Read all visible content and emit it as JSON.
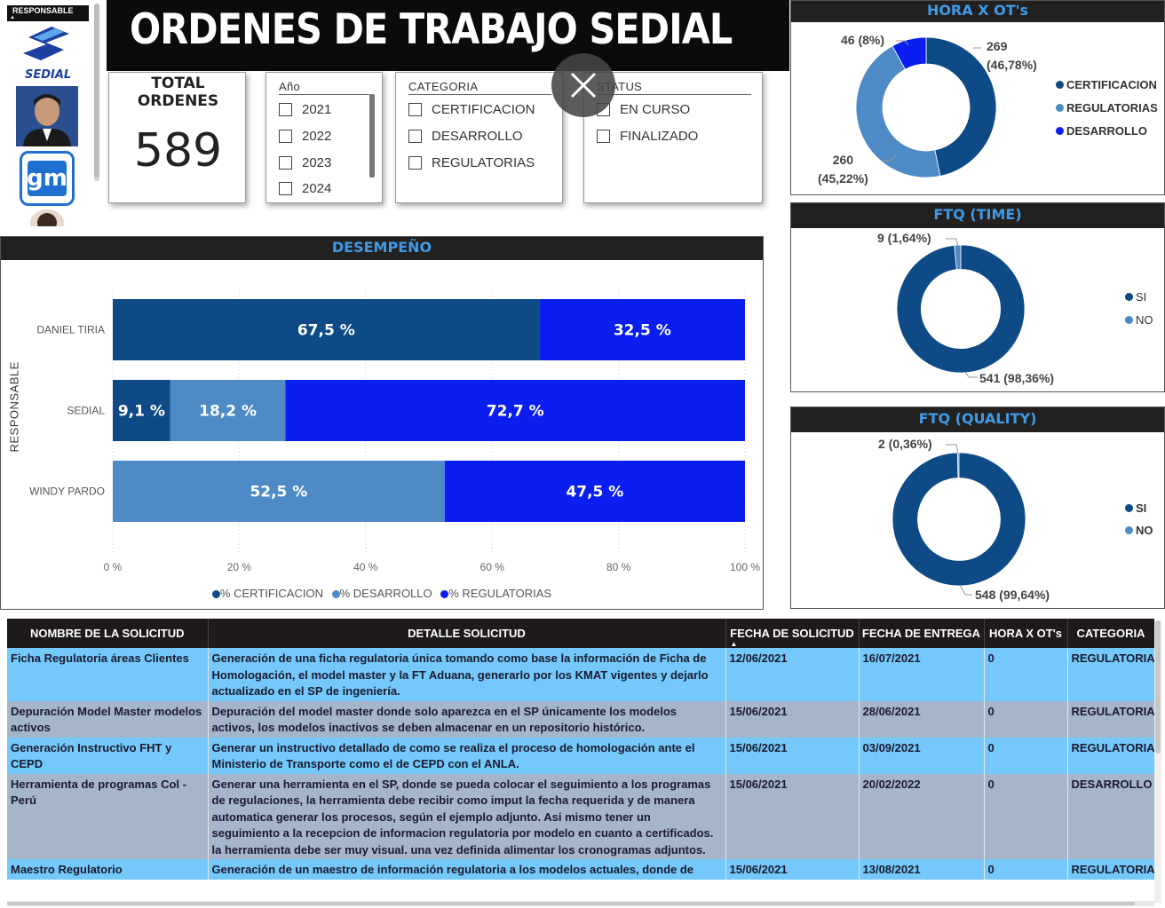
{
  "title": "ORDENES DE TRABAJO SEDIAL",
  "responsable_slicer": {
    "header": "RESPONSABLE",
    "logo_text": "SEDIAL",
    "gm_logo_text": "gm"
  },
  "kpi": {
    "label": "TOTAL ORDENES",
    "value": "589"
  },
  "slicers": {
    "anio": {
      "title": "Año",
      "options": [
        "2021",
        "2022",
        "2023",
        "2024"
      ]
    },
    "categoria": {
      "title": "CATEGORIA",
      "options": [
        "CERTIFICACION",
        "DESARROLLO",
        "REGULATORIAS"
      ]
    },
    "status": {
      "title": "STATUS",
      "options": [
        "EN CURSO",
        "FINALIZADO"
      ]
    }
  },
  "desempeno": {
    "title": "DESEMPEÑO",
    "y_axis_label": "RESPONSABLE",
    "legend": [
      "% CERTIFICACION",
      "% DESARROLLO",
      "% REGULATORIAS"
    ]
  },
  "hora_ot": {
    "title": "HORA X OT's",
    "labels": {
      "desarrollo": "46 (8%)",
      "cert_v": "269",
      "cert_p": "(46,78%)",
      "reg_v": "260",
      "reg_p": "(45,22%)"
    },
    "legend": [
      "CERTIFICACION",
      "REGULATORIAS",
      "DESARROLLO"
    ]
  },
  "ftq_time": {
    "title": "FTQ (TIME)",
    "labels": {
      "no": "9 (1,64%)",
      "si": "541 (98,36%)"
    },
    "legend": [
      "SI",
      "NO"
    ]
  },
  "ftq_quality": {
    "title": "FTQ (QUALITY)",
    "labels": {
      "no": "2 (0,36%)",
      "si": "548 (99,64%)"
    },
    "legend": [
      "SI",
      "NO"
    ]
  },
  "chart_data": [
    {
      "type": "bar",
      "title": "DESEMPEÑO",
      "stacked": "100%",
      "orientation": "horizontal",
      "ylabel": "RESPONSABLE",
      "categories": [
        "DANIEL TIRIA",
        "SEDIAL",
        "WINDY PARDO"
      ],
      "series": [
        {
          "name": "% CERTIFICACION",
          "color": "#0d4a86",
          "values": [
            67.5,
            9.1,
            0
          ]
        },
        {
          "name": "% DESARROLLO",
          "color": "#4d8ac6",
          "values": [
            0,
            18.2,
            52.5
          ]
        },
        {
          "name": "% REGULATORIAS",
          "color": "#0a1ef0",
          "values": [
            32.5,
            72.7,
            47.5
          ]
        }
      ],
      "data_labels": [
        [
          "67,5 %",
          "",
          "32,5 %"
        ],
        [
          "9,1 %",
          "18,2 %",
          "72,7 %"
        ],
        [
          "",
          "52,5 %",
          "47,5 %"
        ]
      ],
      "xlim": [
        0,
        100
      ],
      "xticks": [
        "0 %",
        "20 %",
        "40 %",
        "60 %",
        "80 %",
        "100 %"
      ],
      "legend_position": "bottom",
      "grid": true
    },
    {
      "type": "pie",
      "title": "HORA X OT's",
      "donut": true,
      "categories": [
        "CERTIFICACION",
        "REGULATORIAS",
        "DESARROLLO"
      ],
      "values": [
        269,
        260,
        46
      ],
      "colors": [
        "#0d4a86",
        "#4d8ac6",
        "#0a1ef0"
      ]
    },
    {
      "type": "pie",
      "title": "FTQ (TIME)",
      "donut": true,
      "categories": [
        "SI",
        "NO"
      ],
      "values": [
        541,
        9
      ],
      "colors": [
        "#0d4a86",
        "#4d8ac6"
      ]
    },
    {
      "type": "pie",
      "title": "FTQ (QUALITY)",
      "donut": true,
      "categories": [
        "SI",
        "NO"
      ],
      "values": [
        548,
        2
      ],
      "colors": [
        "#0d4a86",
        "#4d8ac6"
      ]
    }
  ],
  "table": {
    "headers": [
      "NOMBRE DE LA SOLICITUD",
      "DETALLE SOLICITUD",
      "FECHA DE SOLICITUD",
      "FECHA DE ENTREGA",
      "HORA X OT's",
      "CATEGORIA"
    ],
    "rows": [
      [
        "Ficha Regulatoria áreas Clientes",
        "Generación de una ficha regulatoria única tomando como base la información de Ficha de Homologación, el model master y la FT Aduana, generarlo por los KMAT vigentes y dejarlo actualizado en el SP de ingeniería.",
        "12/06/2021",
        "16/07/2021",
        "0",
        "REGULATORIA"
      ],
      [
        "Depuración Model Master modelos activos",
        "Depuración del model master donde solo aparezca en el SP únicamente los modelos activos, los modelos inactivos se deben almacenar en un repositorio histórico.",
        "15/06/2021",
        "28/06/2021",
        "0",
        "REGULATORIA"
      ],
      [
        "Generación Instructivo FHT y CEPD",
        "Generar un instructivo detallado de como se realiza el proceso de homologación ante el Ministerio de Transporte como el de CEPD con el ANLA.",
        "15/06/2021",
        "03/09/2021",
        "0",
        "REGULATORIA"
      ],
      [
        "Herramienta de programas Col - Perú",
        "Generar una herramienta en el SP, donde se pueda colocar el seguimiento a los programas de regulaciones, la herramienta debe recibir como imput la fecha requerida y de manera automatica generar los procesos, según el ejemplo adjunto. Asi mismo tener un seguimiento a la recepcion de informacion regulatoria por modelo en cuanto a certificados. la herramienta debe ser muy visual. una vez definida alimentar los cronogramas adjuntos.",
        "15/06/2021",
        "20/02/2022",
        "0",
        "DESARROLLO"
      ],
      [
        "Maestro Regulatorio",
        "Generación de un maestro de información regulatoria a los modelos actuales, donde de",
        "15/06/2021",
        "13/08/2021",
        "0",
        "REGULATORIA"
      ]
    ]
  }
}
